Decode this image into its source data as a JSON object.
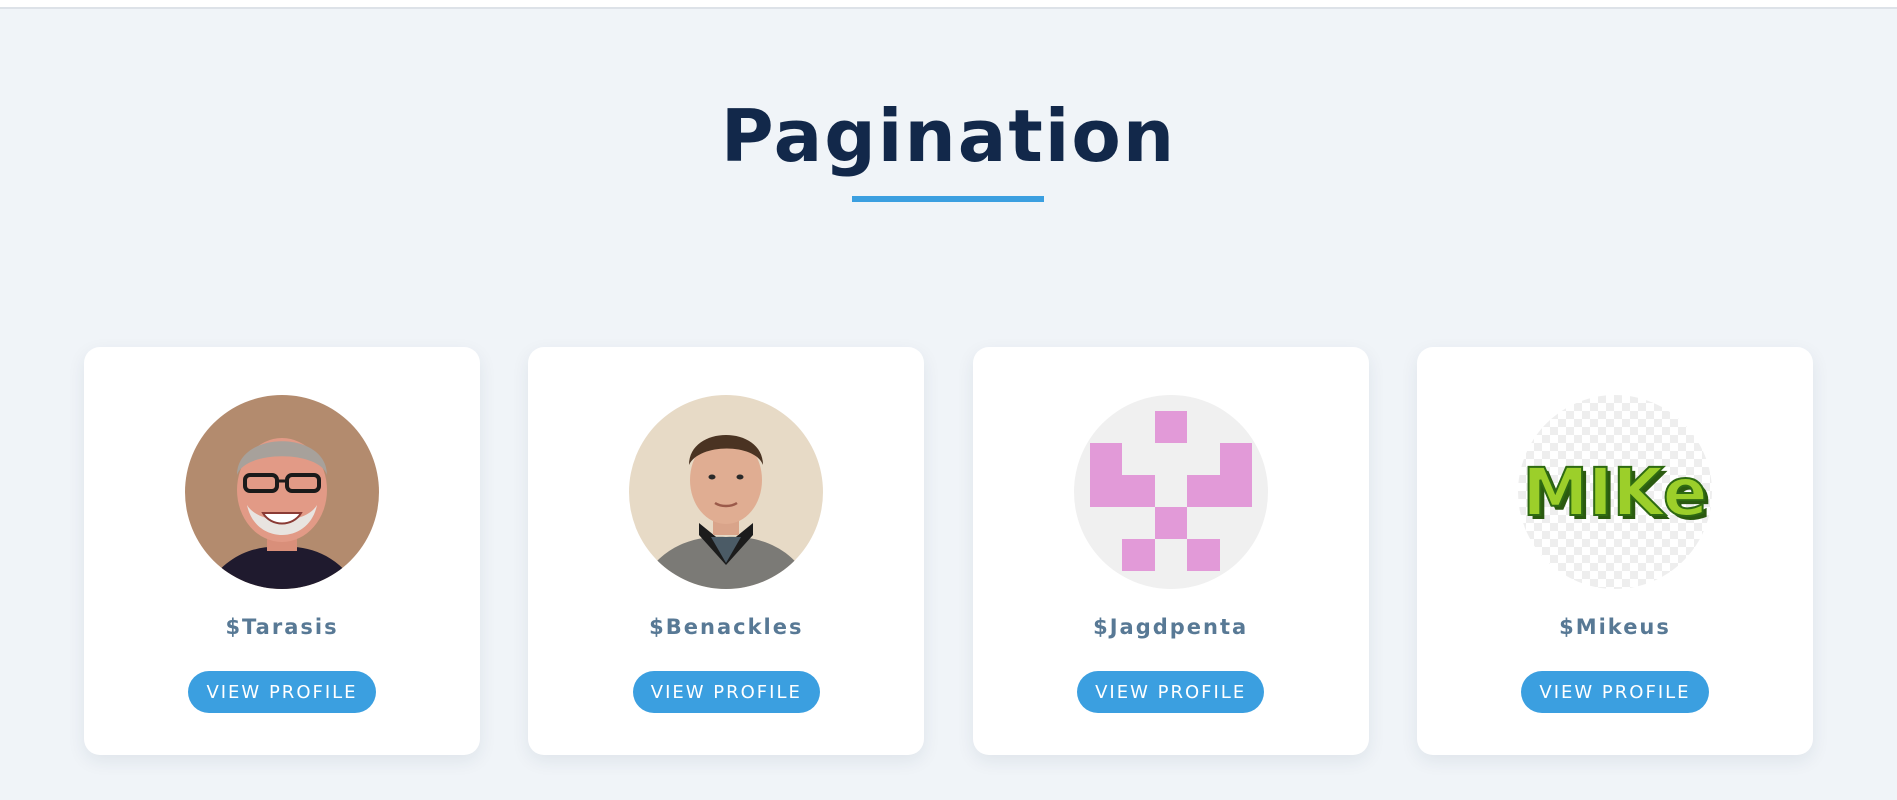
{
  "page": {
    "title": "Pagination"
  },
  "colors": {
    "background": "#f0f4f8",
    "title": "#12284a",
    "accent": "#3b9fe0",
    "username": "#587995",
    "card": "#ffffff"
  },
  "profiles": [
    {
      "username": "$Tarasis",
      "button_label": "VIEW PROFILE",
      "avatar": "photo-older-man-glasses"
    },
    {
      "username": "$Benackles",
      "button_label": "VIEW PROFILE",
      "avatar": "photo-young-man"
    },
    {
      "username": "$Jagdpenta",
      "button_label": "VIEW PROFILE",
      "avatar": "pink-pixel-identicon"
    },
    {
      "username": "$Mikeus",
      "button_label": "VIEW PROFILE",
      "avatar": "mike-logo"
    }
  ]
}
